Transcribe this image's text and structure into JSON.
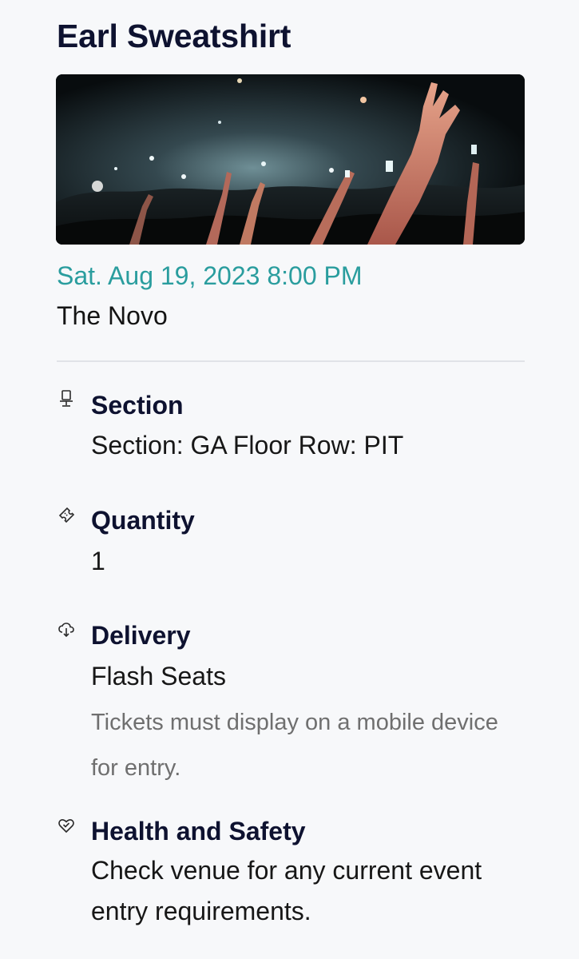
{
  "event": {
    "title": "Earl Sweatshirt",
    "date_time": "Sat. Aug 19, 2023 8:00 PM",
    "venue": "The Novo"
  },
  "details": {
    "section": {
      "icon": "seat-icon",
      "label": "Section",
      "value": "Section: GA Floor Row: PIT"
    },
    "quantity": {
      "icon": "ticket-icon",
      "label": "Quantity",
      "value": "1"
    },
    "delivery": {
      "icon": "delivery-icon",
      "label": "Delivery",
      "value": "Flash Seats",
      "note": "Tickets must display on a mobile device for entry."
    },
    "health": {
      "icon": "heart-check-icon",
      "label": "Health and Safety",
      "value": "Check venue for any current event entry requirements."
    }
  },
  "colors": {
    "accent_date": "#2a9d9e",
    "title": "#0e1230",
    "background": "#f7f8fa"
  }
}
